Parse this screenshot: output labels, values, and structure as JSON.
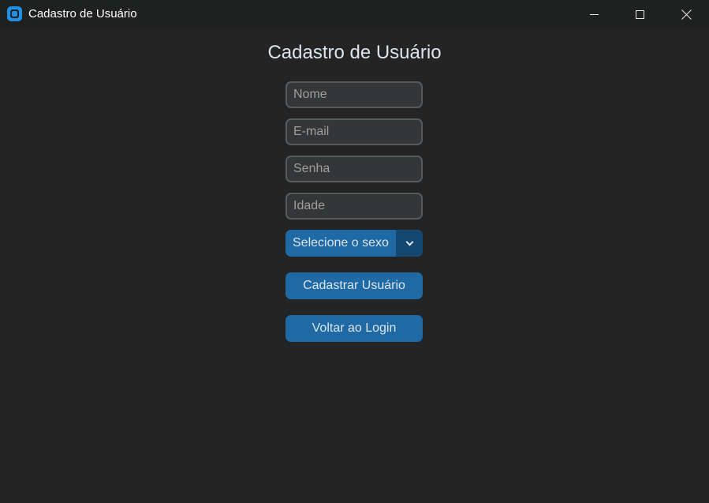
{
  "window": {
    "title": "Cadastro de Usuário",
    "icon": "app-logo-icon",
    "controls": [
      "minimize-icon",
      "maximize-icon",
      "close-icon"
    ]
  },
  "form": {
    "heading": "Cadastro de Usuário",
    "fields": {
      "name": {
        "value": "",
        "placeholder": "Nome"
      },
      "email": {
        "value": "",
        "placeholder": "E-mail"
      },
      "password": {
        "value": "",
        "placeholder": "Senha"
      },
      "age": {
        "value": "",
        "placeholder": "Idade"
      }
    },
    "sex_select": {
      "selected": "Selecione o sexo"
    },
    "register_label": "Cadastrar Usuário",
    "back_label": "Voltar ao Login"
  },
  "colors": {
    "background": "#242424",
    "titlebar": "#1f2020",
    "accent": "#1f6aa5",
    "accent_dark": "#144870",
    "entry_bg": "#343638",
    "entry_border": "#565b5e",
    "text": "#dce4ee"
  }
}
